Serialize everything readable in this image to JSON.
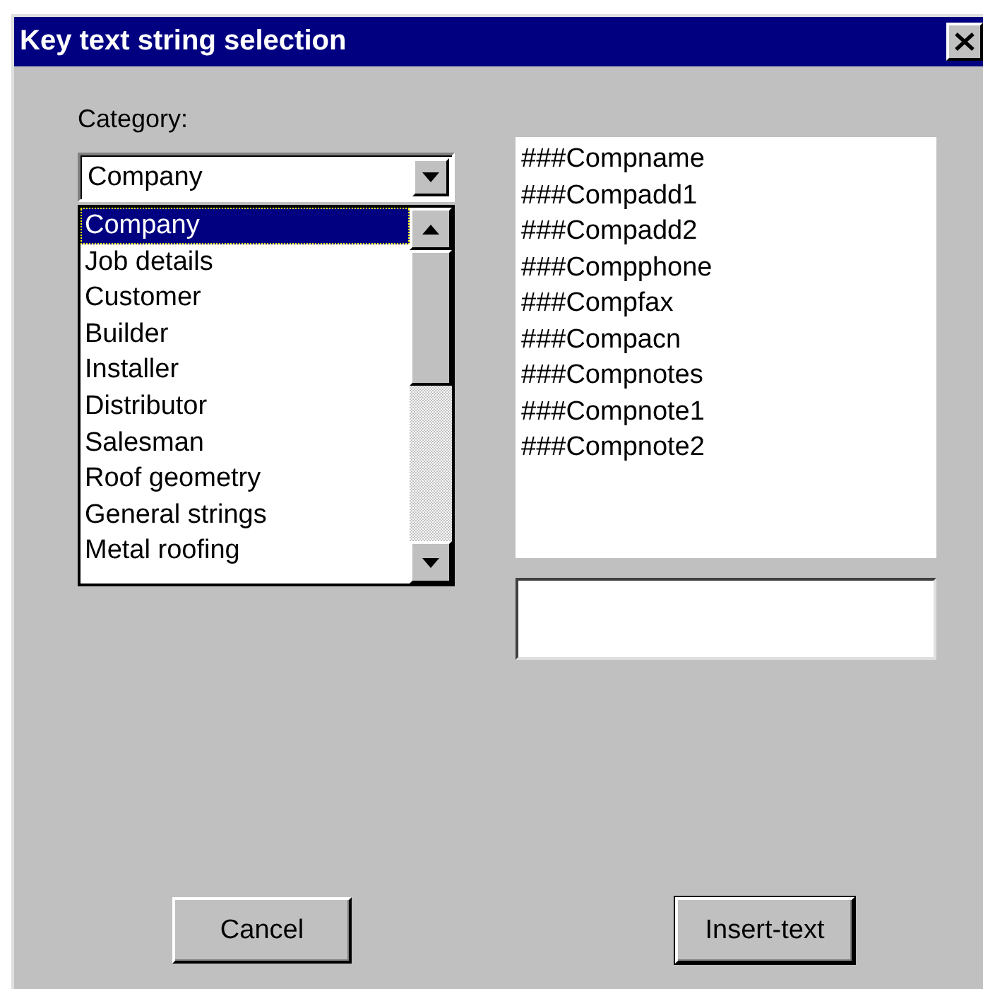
{
  "window": {
    "title": "Key text string selection"
  },
  "category": {
    "label": "Category:",
    "value": "Company",
    "items": [
      {
        "label": "Company",
        "selected": true
      },
      {
        "label": "Job details",
        "selected": false
      },
      {
        "label": "Customer",
        "selected": false
      },
      {
        "label": "Builder",
        "selected": false
      },
      {
        "label": "Installer",
        "selected": false
      },
      {
        "label": "Distributor",
        "selected": false
      },
      {
        "label": "Salesman",
        "selected": false
      },
      {
        "label": "Roof geometry",
        "selected": false
      },
      {
        "label": "General strings",
        "selected": false
      },
      {
        "label": "Metal roofing",
        "selected": false
      }
    ]
  },
  "strings": [
    {
      "label": "###Compname",
      "selected": false
    },
    {
      "label": "###Compadd1",
      "selected": false
    },
    {
      "label": "###Compadd2",
      "selected": false
    },
    {
      "label": "###Compphone",
      "selected": false
    },
    {
      "label": "###Compfax",
      "selected": false
    },
    {
      "label": "###Compacn",
      "selected": false
    },
    {
      "label": "###Compnotes",
      "selected": false
    },
    {
      "label": "###Compnote1",
      "selected": false
    },
    {
      "label": "###Compnote2",
      "selected": false
    }
  ],
  "buttons": [
    {
      "label": "Cancel",
      "default": false
    },
    {
      "label": "Insert-text",
      "default": true
    }
  ]
}
